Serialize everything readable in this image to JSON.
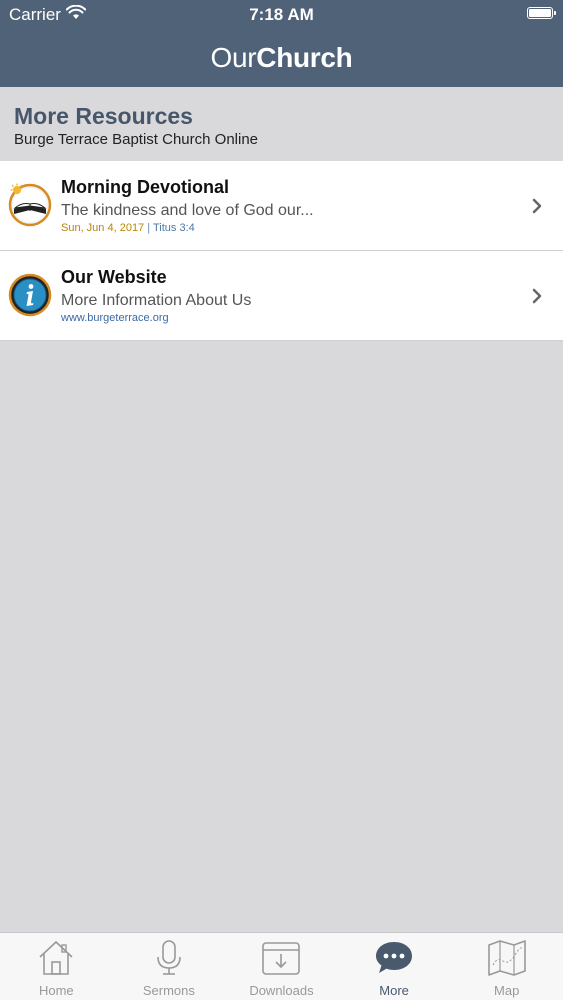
{
  "status_bar": {
    "carrier": "Carrier",
    "time": "7:18 AM"
  },
  "brand": {
    "light": "Our",
    "bold": "Church"
  },
  "section": {
    "title": "More Resources",
    "subtitle": "Burge Terrace Baptist Church Online"
  },
  "items": [
    {
      "title": "Morning Devotional",
      "description": "The kindness and love of God our...",
      "date": "Sun, Jun 4, 2017",
      "separator": "|",
      "reference": "Titus 3:4",
      "icon": "sunrise-bible-icon"
    },
    {
      "title": "Our Website",
      "description": "More Information About Us",
      "url": "www.burgeterrace.org",
      "icon": "info-icon"
    }
  ],
  "tabs": [
    {
      "label": "Home",
      "icon": "home-icon"
    },
    {
      "label": "Sermons",
      "icon": "microphone-icon"
    },
    {
      "label": "Downloads",
      "icon": "download-icon"
    },
    {
      "label": "More",
      "icon": "chat-bubble-icon",
      "active": true
    },
    {
      "label": "Map",
      "icon": "map-icon"
    }
  ],
  "colors": {
    "nav_bar": "#506278",
    "background": "#d9d9db",
    "section_title": "#47566a",
    "date": "#b8860b",
    "link": "#3a6aa6"
  }
}
